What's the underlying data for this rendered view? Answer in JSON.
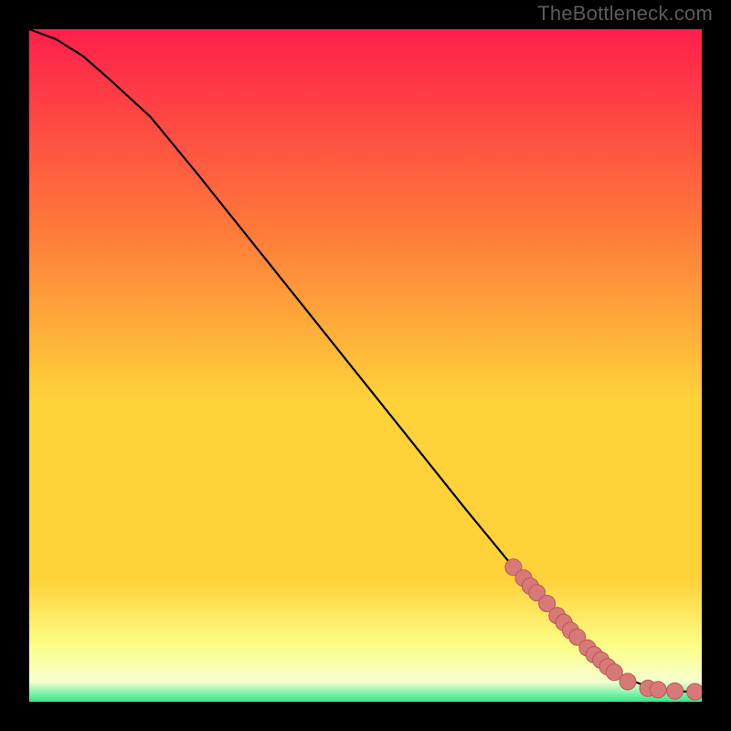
{
  "attribution": "TheBottleneck.com",
  "colors": {
    "frame": "#000000",
    "grad_top": "#ff1f4b",
    "grad_mid_upper": "#ff7a3a",
    "grad_mid": "#ffd23a",
    "grad_low_yellow": "#fcff8a",
    "grad_pale": "#f6ffd0",
    "grad_green": "#2ee98c",
    "curve": "#000000",
    "marker_fill": "#d87877",
    "marker_stroke": "#b85a58"
  },
  "chart_data": {
    "type": "line",
    "title": "",
    "xlabel": "",
    "ylabel": "",
    "xlim": [
      0,
      100
    ],
    "ylim": [
      0,
      100
    ],
    "curve": {
      "x": [
        0,
        4,
        8,
        12,
        18,
        25,
        35,
        45,
        55,
        65,
        72,
        78,
        82,
        85,
        88,
        90,
        92,
        94,
        96,
        98,
        100
      ],
      "y": [
        100,
        98.5,
        96,
        92.5,
        87,
        78.5,
        66,
        53.5,
        41,
        28.5,
        20,
        13,
        9,
        6,
        4,
        3,
        2.2,
        1.8,
        1.6,
        1.5,
        1.5
      ]
    },
    "markers": {
      "x": [
        72,
        73.5,
        74.5,
        75.5,
        77,
        78.5,
        79.5,
        80.5,
        81.5,
        83,
        84,
        85,
        86,
        87,
        89,
        92,
        93.5,
        96,
        99
      ],
      "y": [
        20,
        18.4,
        17.2,
        16.2,
        14.6,
        12.8,
        11.8,
        10.6,
        9.6,
        8,
        7,
        6.2,
        5.2,
        4.4,
        3,
        2,
        1.8,
        1.6,
        1.5
      ]
    }
  }
}
